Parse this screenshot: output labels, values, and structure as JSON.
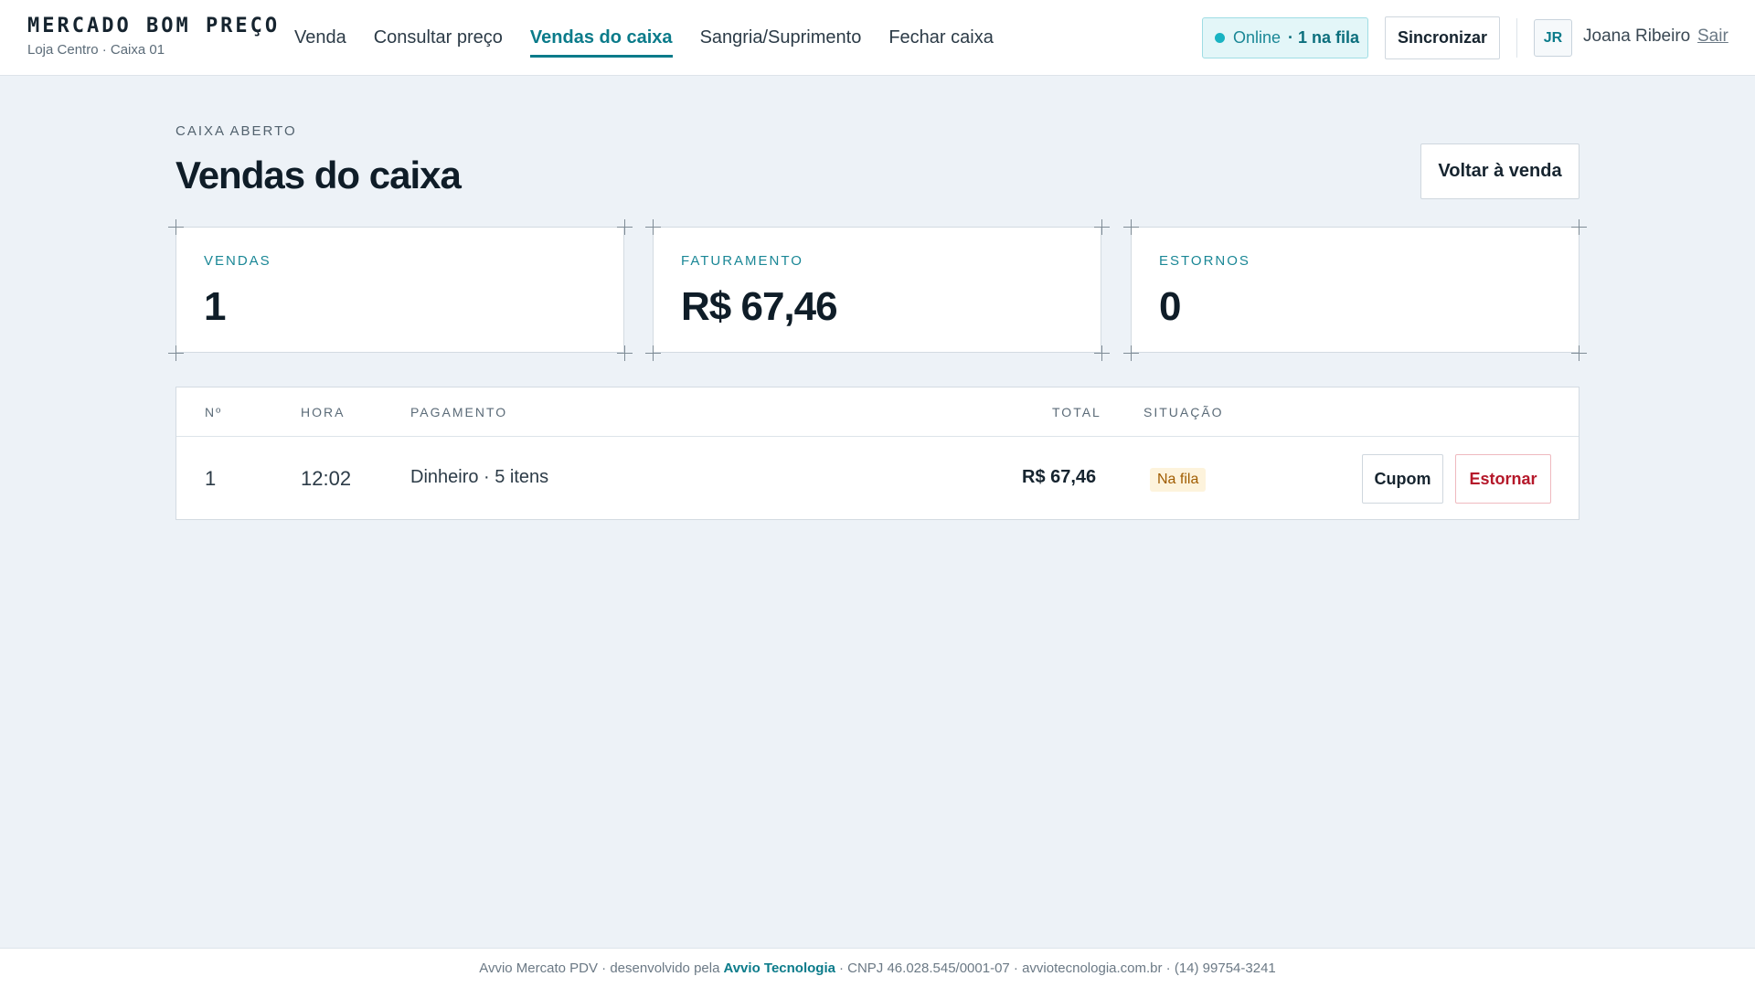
{
  "header": {
    "brand": "MERCADO BOM PREÇO",
    "store": "Loja Centro · Caixa 01",
    "nav": [
      {
        "label": "Venda"
      },
      {
        "label": "Consultar preço"
      },
      {
        "label": "Vendas do caixa",
        "active": true
      },
      {
        "label": "Sangria/Suprimento"
      },
      {
        "label": "Fechar caixa"
      }
    ],
    "status": {
      "online": "Online",
      "queue": "· 1 na fila"
    },
    "sync_label": "Sincronizar",
    "user": {
      "initials": "JR",
      "name": "Joana Ribeiro",
      "logout": "Sair"
    }
  },
  "page": {
    "eyebrow": "CAIXA ABERTO",
    "title": "Vendas do caixa",
    "back_label": "Voltar à venda"
  },
  "stats": [
    {
      "label": "VENDAS",
      "value": "1"
    },
    {
      "label": "FATURAMENTO",
      "value": "R$ 67,46"
    },
    {
      "label": "ESTORNOS",
      "value": "0"
    }
  ],
  "table": {
    "columns": [
      "Nº",
      "HORA",
      "PAGAMENTO",
      "TOTAL",
      "SITUAÇÃO"
    ],
    "rows": [
      {
        "num": "1",
        "time": "12:02",
        "payment": "Dinheiro · 5 itens",
        "total": "R$ 67,46",
        "status": "Na fila",
        "actions": {
          "receipt": "Cupom",
          "refund": "Estornar"
        }
      }
    ]
  },
  "footer": {
    "prefix": "Avvio Mercato PDV · desenvolvido pela",
    "company": "Avvio Tecnologia",
    "suffix": "· CNPJ 46.028.545/0001-07 · avviotecnologia.com.br · (14) 99754-3241"
  },
  "colors": {
    "accent": "#0b7b8a",
    "background": "#edf2f7",
    "danger": "#b5182a",
    "warning_badge": "#fdf3dc"
  }
}
